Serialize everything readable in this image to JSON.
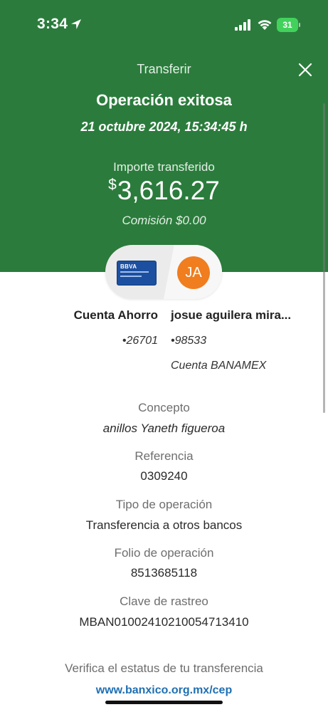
{
  "status_bar": {
    "time": "3:34",
    "battery": "31"
  },
  "header": {
    "nav_title": "Transferir",
    "title": "Operación exitosa",
    "datetime": "21 octubre 2024, 15:34:45 h",
    "amount_label": "Importe transferido",
    "currency_symbol": "$",
    "amount": "3,616.27",
    "commission": "Comisión  $0.00",
    "bg_color": "#2b7c3c"
  },
  "accounts": {
    "from_bank_logo_text": "BBVA",
    "to_initials": "JA",
    "from_name": "Cuenta Ahorro",
    "from_number": "•26701",
    "to_name": "josue aguilera mira...",
    "to_number": "•98533",
    "to_bank": "Cuenta BANAMEX"
  },
  "details": [
    {
      "label": "Concepto",
      "value": "anillos Yaneth figueroa"
    },
    {
      "label": "Referencia",
      "value": "0309240"
    },
    {
      "label": "Tipo de operación",
      "value": "Transferencia a otros bancos"
    },
    {
      "label": "Folio de operación",
      "value": "8513685118"
    },
    {
      "label": "Clave de rastreo",
      "value": "MBAN01002410210054713410"
    }
  ],
  "footer": {
    "verify_text": "Verifica el estatus de tu transferencia",
    "link": "www.banxico.org.mx/cep",
    "link_color": "#1f6fb2"
  },
  "icons": [
    "location-arrow-icon",
    "signal-icon",
    "wifi-icon",
    "battery-icon",
    "close-icon",
    "bank-card-icon"
  ]
}
